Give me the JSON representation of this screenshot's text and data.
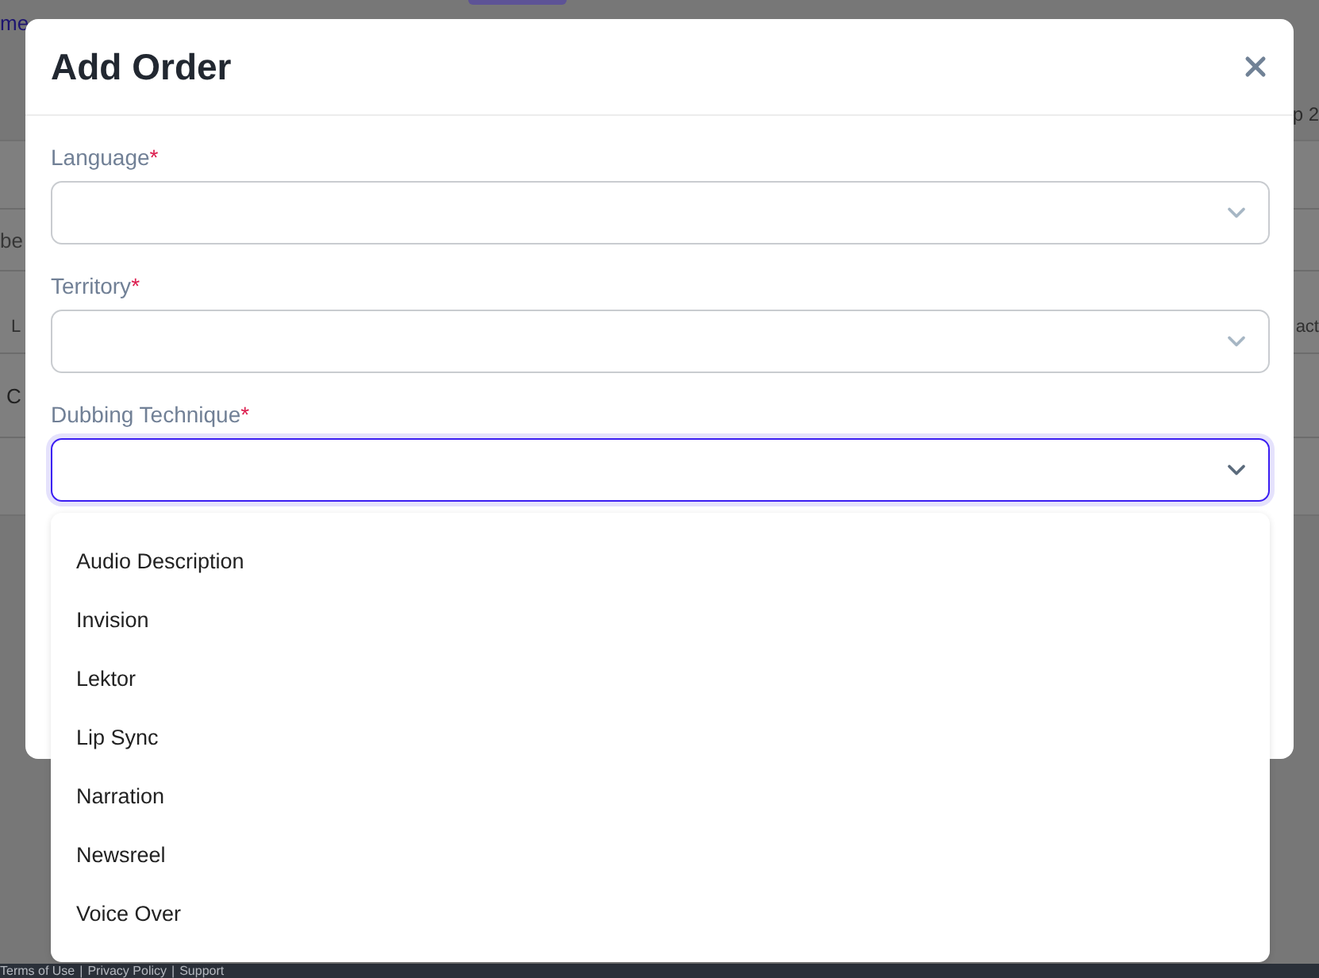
{
  "background": {
    "subtitle_link": "me",
    "step_fragment": "p 2",
    "search_placeholder": "be",
    "table": {
      "columns": [
        "L",
        "act"
      ],
      "rows": [
        [
          "C"
        ]
      ]
    },
    "footer": {
      "links": [
        "Terms of Use",
        "Privacy Policy",
        "Support"
      ],
      "separator": "|"
    }
  },
  "dialog": {
    "title": "Add Order",
    "fields": [
      {
        "label": "Language",
        "required_mark": "*",
        "focused": false
      },
      {
        "label": "Territory",
        "required_mark": "*",
        "focused": false
      },
      {
        "label": "Dubbing Technique",
        "required_mark": "*",
        "focused": true,
        "options": [
          "Audio Description",
          "Invision",
          "Lektor",
          "Lip Sync",
          "Narration",
          "Newsreel",
          "Voice Over"
        ]
      }
    ]
  }
}
